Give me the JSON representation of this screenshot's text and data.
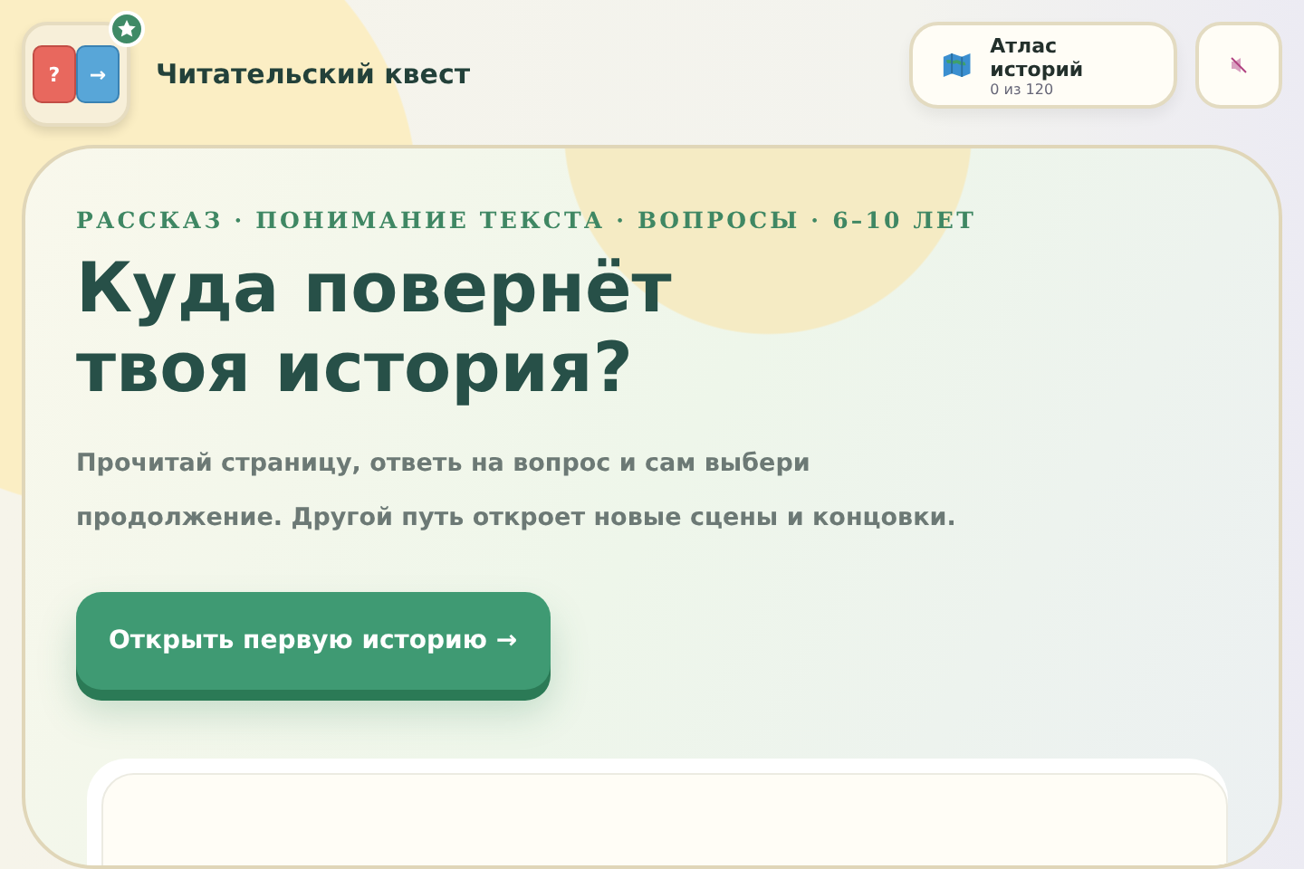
{
  "header": {
    "logo": {
      "left_tile": "?",
      "right_tile": "→"
    },
    "title": "Читательский квест",
    "atlas": {
      "label": "Атлас историй",
      "count": "0 из 120"
    },
    "sound": {
      "muted": true
    }
  },
  "hero": {
    "kicker": "РАССКАЗ · ПОНИМАНИЕ ТЕКСТА · ВОПРОСЫ · 6–10 ЛЕТ",
    "heading": "Куда повернёт твоя история?",
    "description": "Прочитай страницу, ответь на вопрос и сам выбери продолжение. Другой путь откроет новые сцены и концовки.",
    "button": "Открыть первую историю →"
  }
}
